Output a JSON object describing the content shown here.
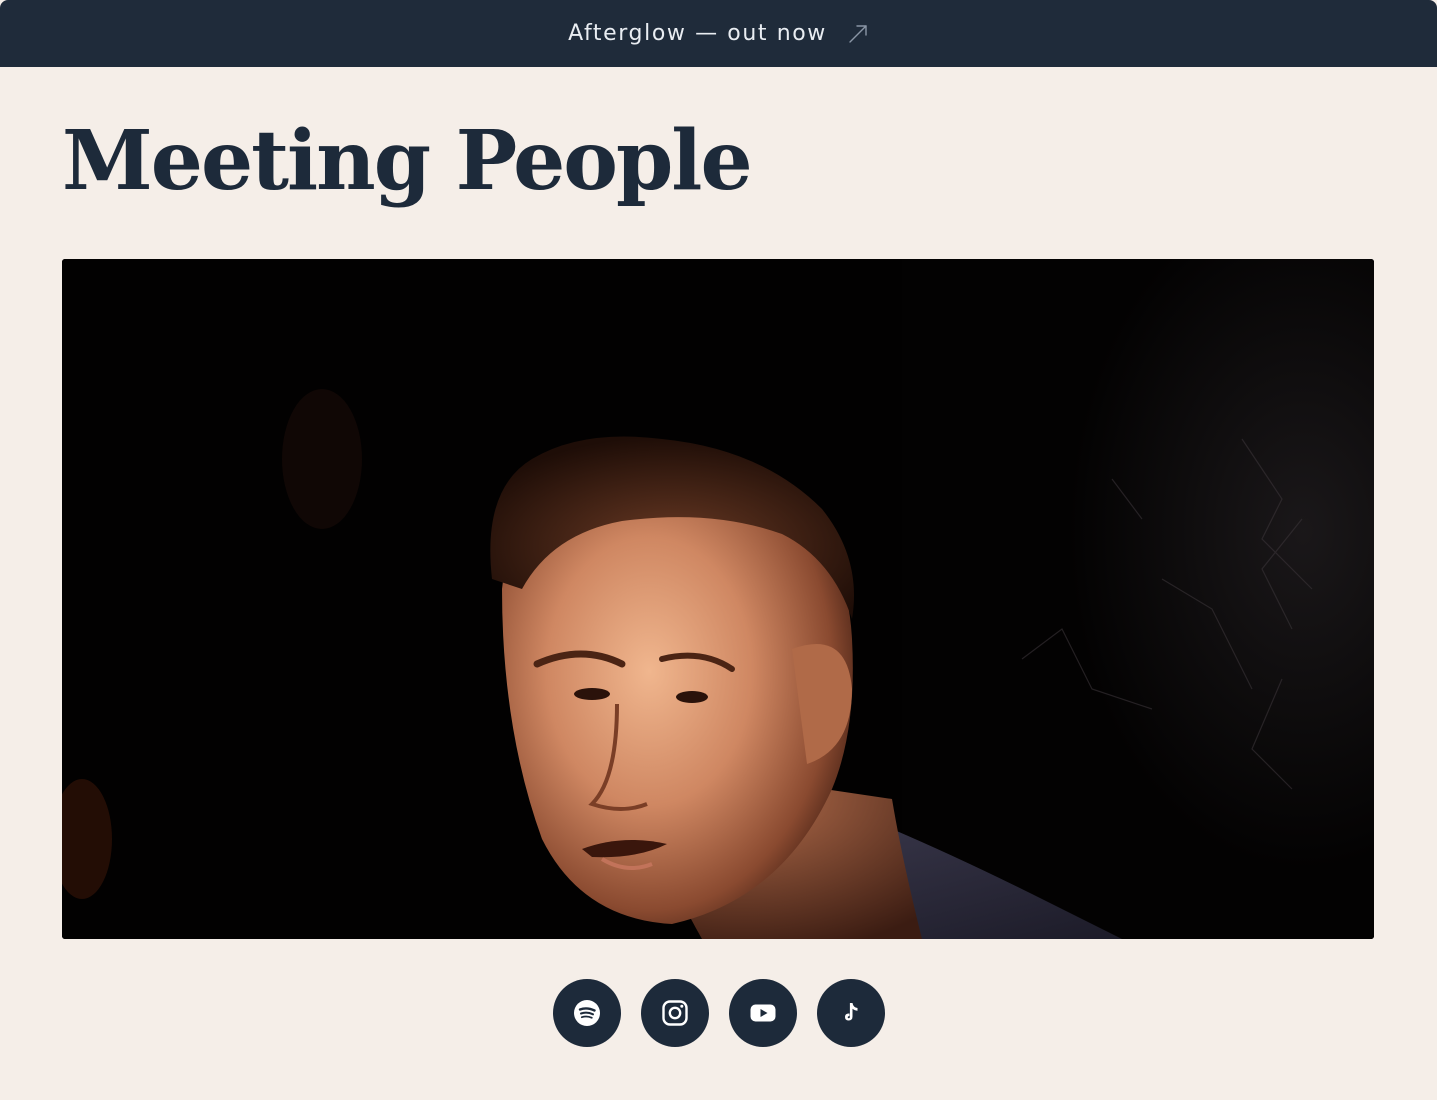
{
  "banner": {
    "text": "Afterglow — out now",
    "icon": "arrow-up-right-icon"
  },
  "page": {
    "title": "Meeting People"
  },
  "photo": {
    "description_icon": "artist-portrait-image"
  },
  "socials": [
    {
      "name": "Spotify",
      "icon": "spotify-icon"
    },
    {
      "name": "Instagram",
      "icon": "instagram-icon"
    },
    {
      "name": "YouTube",
      "icon": "youtube-icon"
    },
    {
      "name": "TikTok",
      "icon": "tiktok-icon"
    }
  ],
  "colors": {
    "background": "#f5eee8",
    "navy": "#1d2a3a",
    "banner": "#1f2b3a",
    "banner_text": "#e9edf2"
  }
}
